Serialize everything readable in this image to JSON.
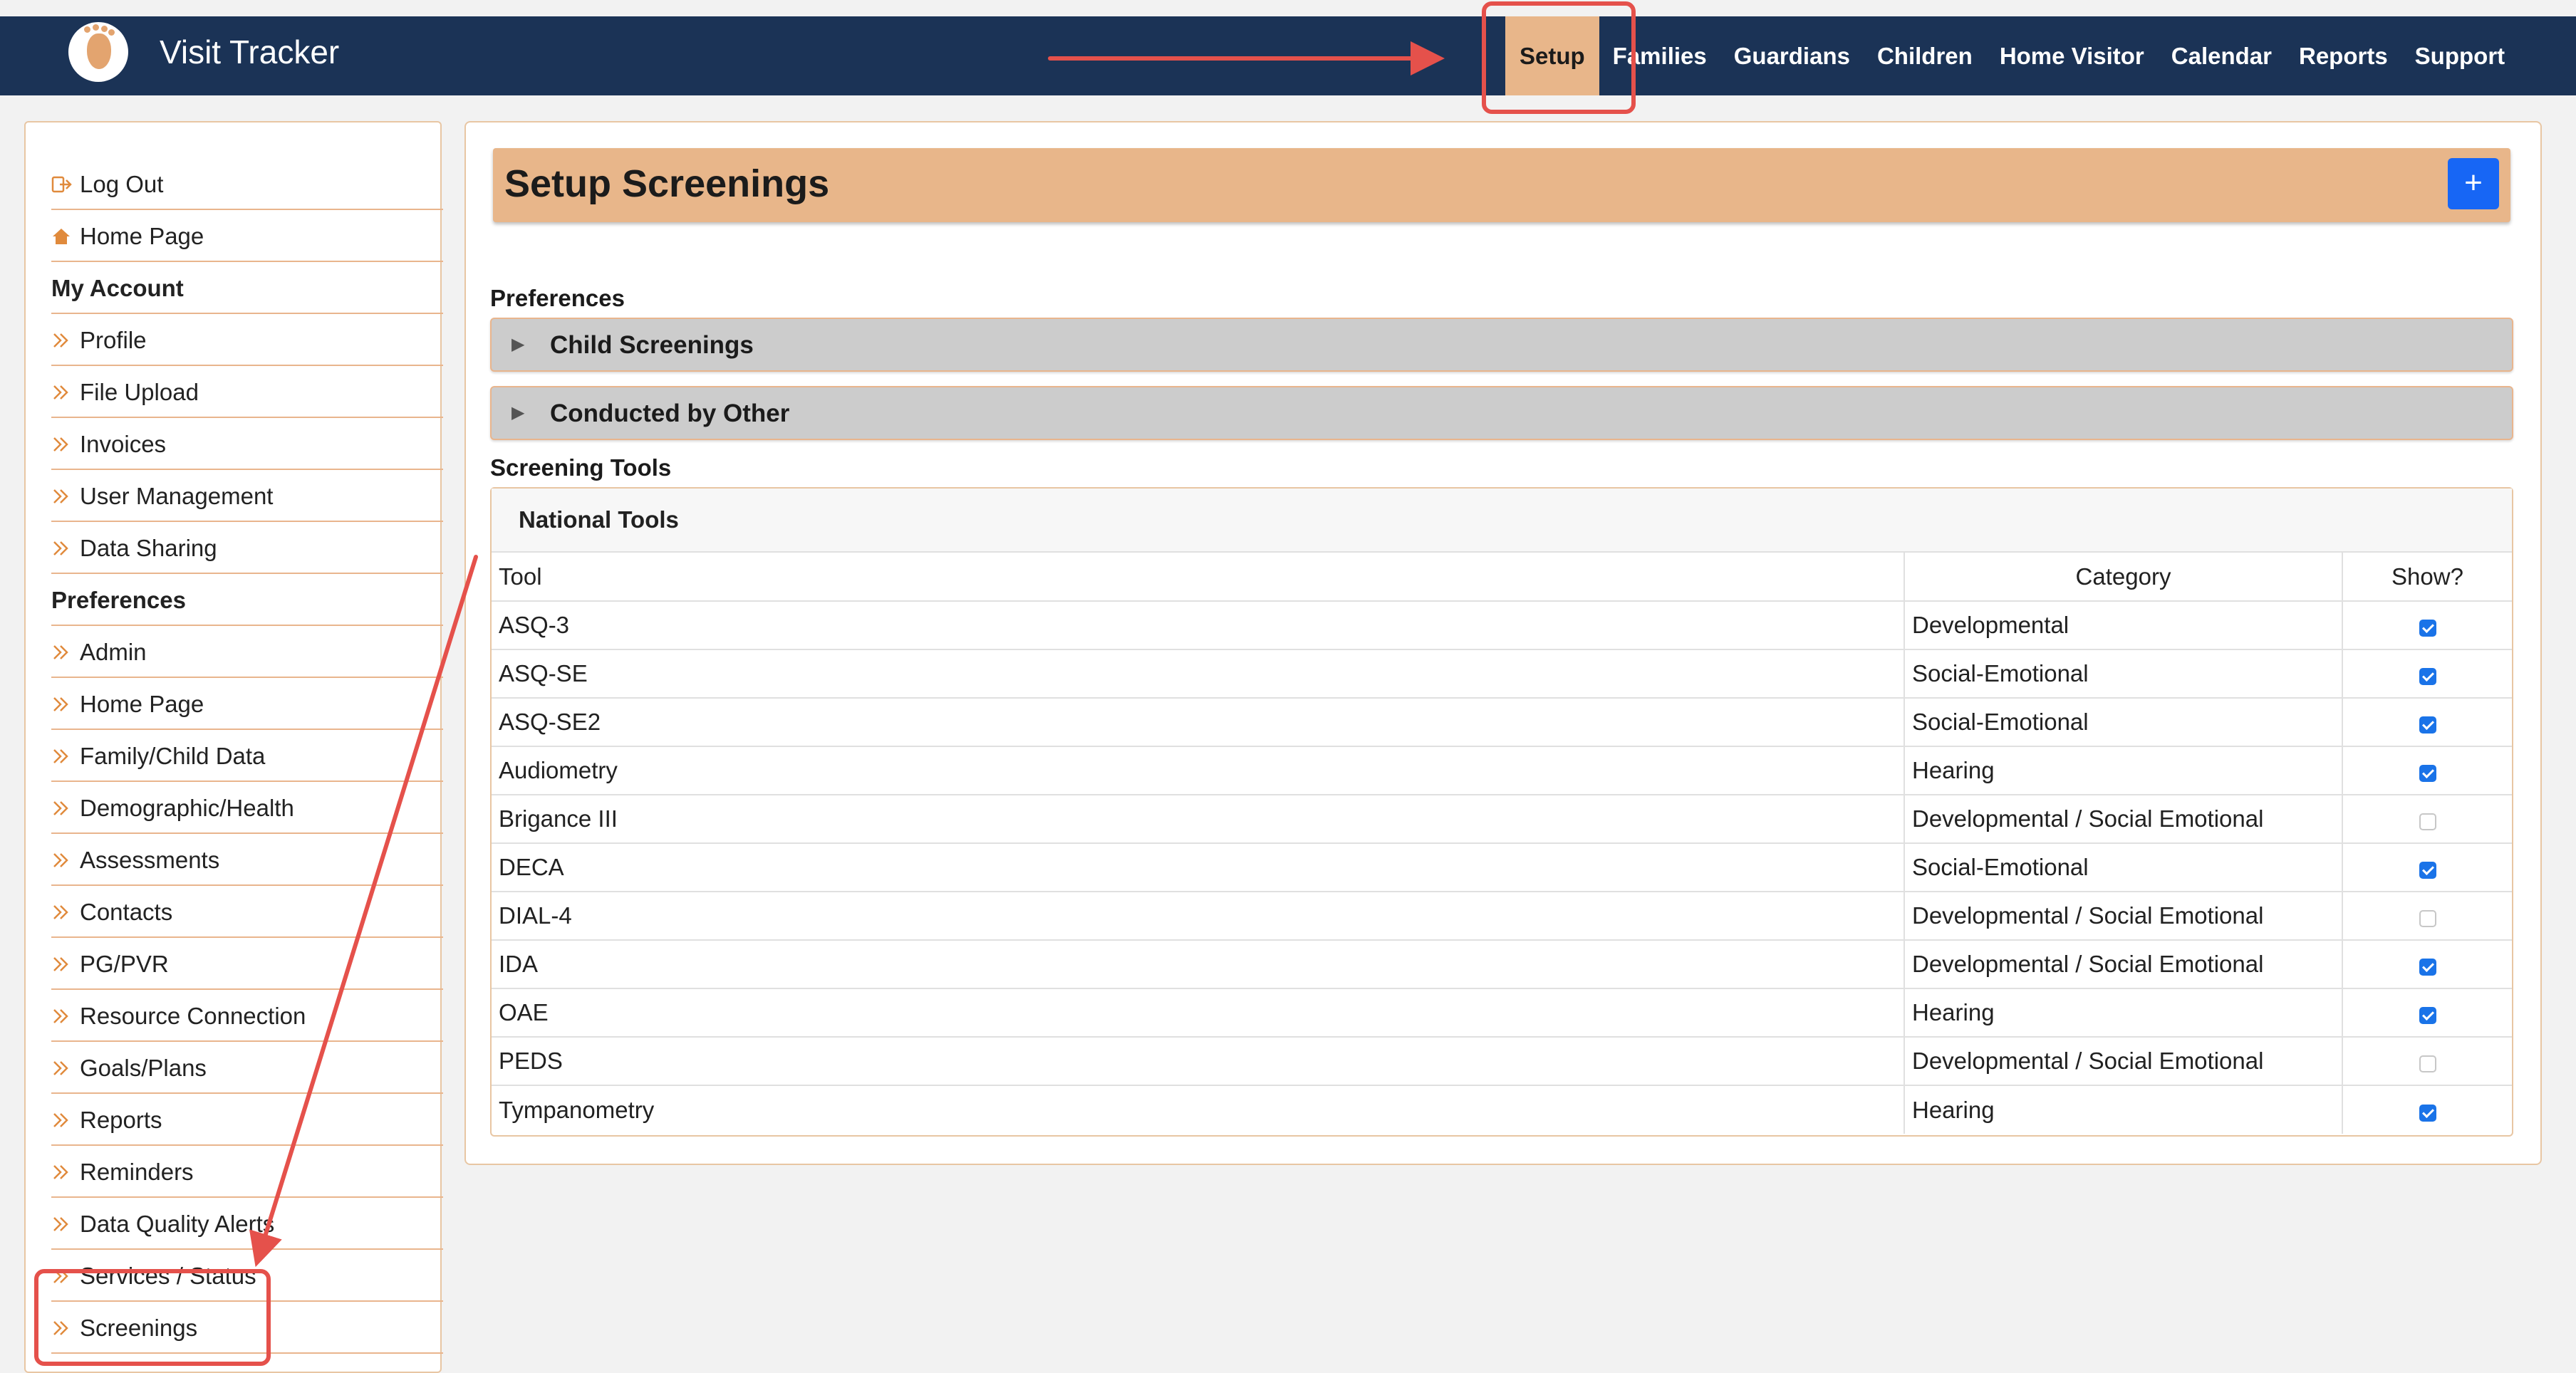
{
  "app": {
    "title": "Visit Tracker"
  },
  "nav": {
    "items": [
      {
        "label": "Setup",
        "active": true
      },
      {
        "label": "Families"
      },
      {
        "label": "Guardians"
      },
      {
        "label": "Children"
      },
      {
        "label": "Home Visitor"
      },
      {
        "label": "Calendar"
      },
      {
        "label": "Reports"
      },
      {
        "label": "Support"
      }
    ]
  },
  "sidebar": {
    "items": [
      {
        "label": "Log Out",
        "icon": "logout-icon"
      },
      {
        "label": "Home Page",
        "icon": "home-icon"
      },
      {
        "label": "My Account",
        "heading": true
      },
      {
        "label": "Profile",
        "icon": "chevron-double-right-icon"
      },
      {
        "label": "File Upload",
        "icon": "chevron-double-right-icon"
      },
      {
        "label": "Invoices",
        "icon": "chevron-double-right-icon"
      },
      {
        "label": "User Management",
        "icon": "chevron-double-right-icon"
      },
      {
        "label": "Data Sharing",
        "icon": "chevron-double-right-icon"
      },
      {
        "label": "Preferences",
        "heading": true
      },
      {
        "label": "Admin",
        "icon": "chevron-double-right-icon"
      },
      {
        "label": "Home Page",
        "icon": "chevron-double-right-icon"
      },
      {
        "label": "Family/Child Data",
        "icon": "chevron-double-right-icon"
      },
      {
        "label": "Demographic/Health",
        "icon": "chevron-double-right-icon"
      },
      {
        "label": "Assessments",
        "icon": "chevron-double-right-icon"
      },
      {
        "label": "Contacts",
        "icon": "chevron-double-right-icon"
      },
      {
        "label": "PG/PVR",
        "icon": "chevron-double-right-icon"
      },
      {
        "label": "Resource Connection",
        "icon": "chevron-double-right-icon"
      },
      {
        "label": "Goals/Plans",
        "icon": "chevron-double-right-icon"
      },
      {
        "label": "Reports",
        "icon": "chevron-double-right-icon"
      },
      {
        "label": "Reminders",
        "icon": "chevron-double-right-icon"
      },
      {
        "label": "Data Quality Alerts",
        "icon": "chevron-double-right-icon"
      },
      {
        "label": "Services / Status",
        "icon": "chevron-double-right-icon"
      },
      {
        "label": "Screenings",
        "icon": "chevron-double-right-icon"
      }
    ]
  },
  "main": {
    "title": "Setup Screenings",
    "add_button_label": "+",
    "preferences_label": "Preferences",
    "accordions": [
      {
        "label": "Child Screenings",
        "caret": "▶"
      },
      {
        "label": "Conducted by Other",
        "caret": "▶"
      }
    ],
    "screening_tools_label": "Screening Tools",
    "tools_card": {
      "header": "National Tools",
      "columns": {
        "tool": "Tool",
        "category": "Category",
        "show": "Show?"
      },
      "rows": [
        {
          "tool": "ASQ-3",
          "category": "Developmental",
          "show": true
        },
        {
          "tool": "ASQ-SE",
          "category": "Social-Emotional",
          "show": true
        },
        {
          "tool": "ASQ-SE2",
          "category": "Social-Emotional",
          "show": true
        },
        {
          "tool": "Audiometry",
          "category": "Hearing",
          "show": true
        },
        {
          "tool": "Brigance III",
          "category": "Developmental / Social Emotional",
          "show": false
        },
        {
          "tool": "DECA",
          "category": "Social-Emotional",
          "show": true
        },
        {
          "tool": "DIAL-4",
          "category": "Developmental / Social Emotional",
          "show": false
        },
        {
          "tool": "IDA",
          "category": "Developmental / Social Emotional",
          "show": true
        },
        {
          "tool": "OAE",
          "category": "Hearing",
          "show": true
        },
        {
          "tool": "PEDS",
          "category": "Developmental / Social Emotional",
          "show": false
        },
        {
          "tool": "Tympanometry",
          "category": "Hearing",
          "show": true
        }
      ]
    }
  },
  "colors": {
    "nav_bg": "#1b3356",
    "accent": "#e8b68a",
    "primary_button": "#1766f5",
    "annotation": "#e5514b"
  }
}
